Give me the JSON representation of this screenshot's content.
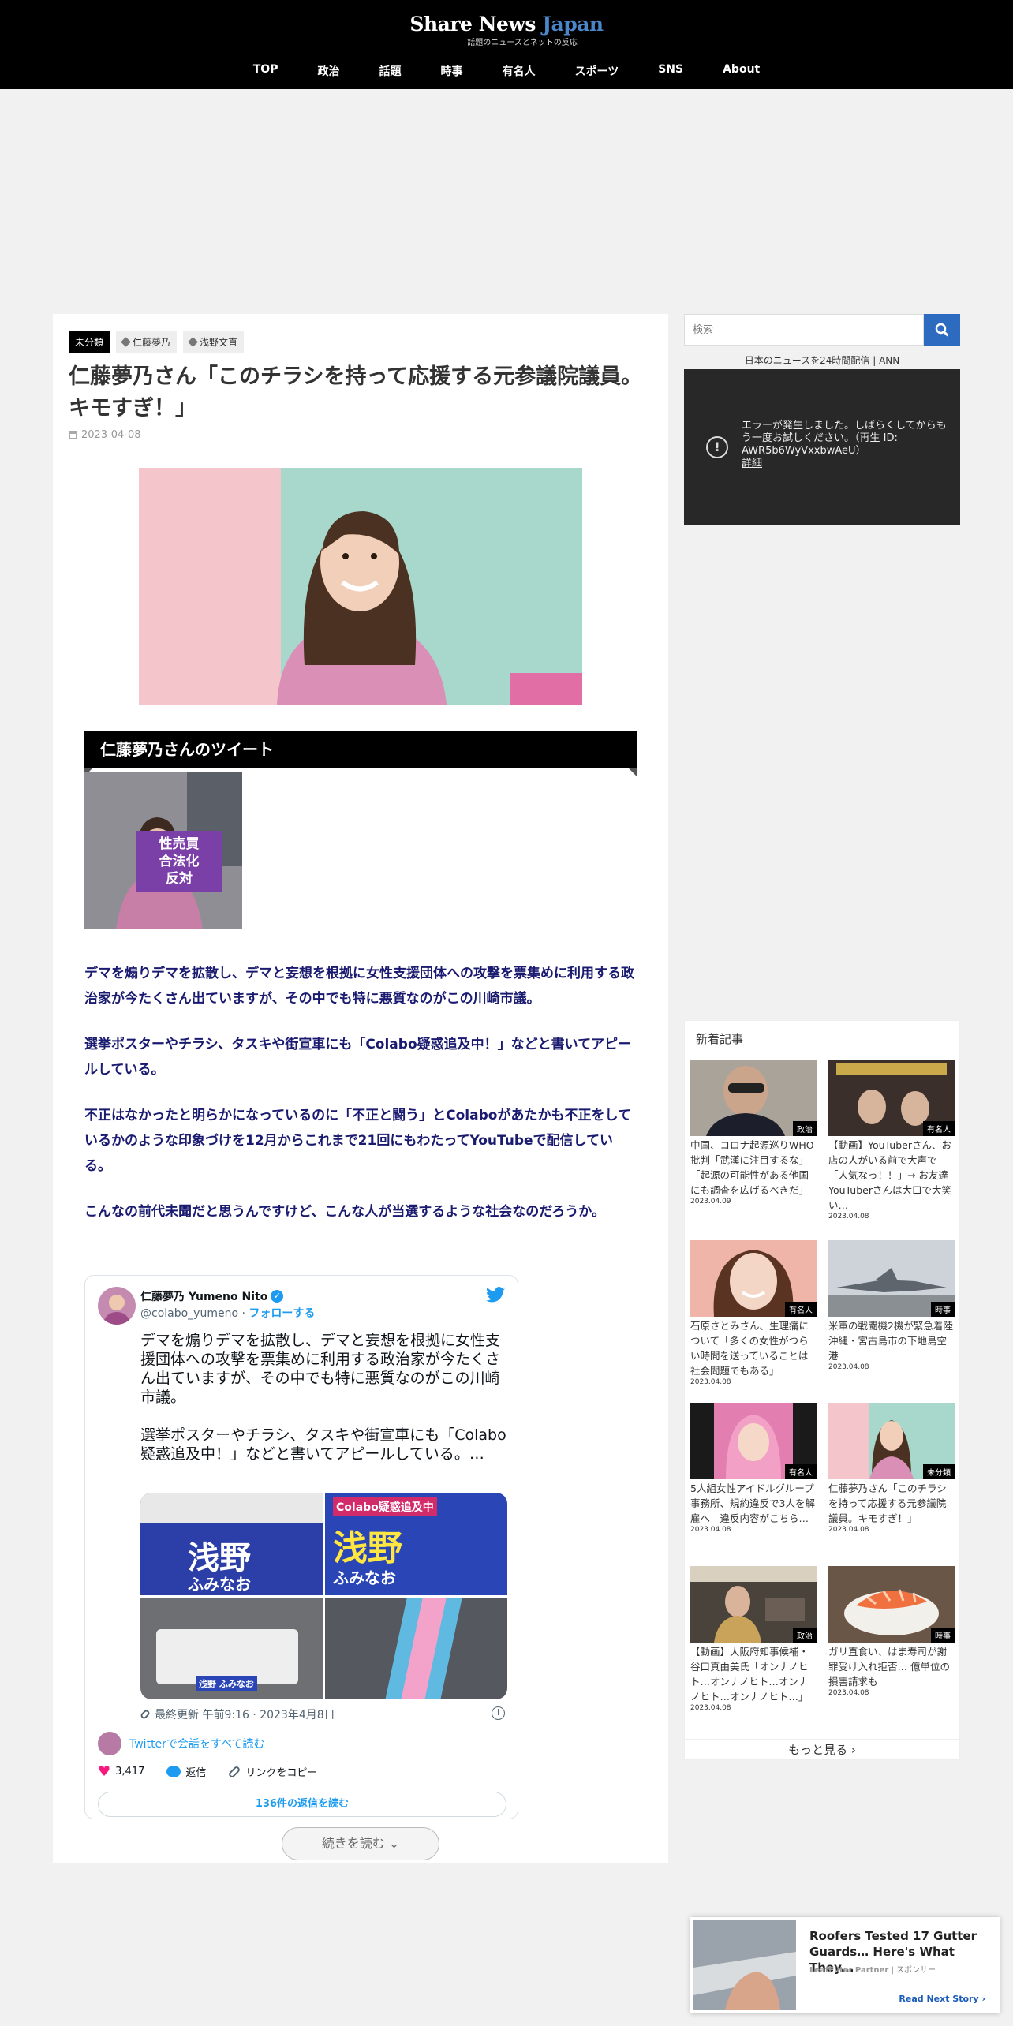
{
  "site": {
    "logo_main": "Share News ",
    "logo_accent": "Japan",
    "logo_sub": "話題のニュースとネットの反応",
    "nav": [
      "TOP",
      "政治",
      "話題",
      "時事",
      "有名人",
      "スポーツ",
      "SNS",
      "About"
    ]
  },
  "article": {
    "category": "未分類",
    "tags": [
      "仁藤夢乃",
      "浅野文直"
    ],
    "title": "仁藤夢乃さん「このチラシを持って応援する元参議院議員。キモすぎ！」",
    "date": "2023-04-08",
    "h2": "仁藤夢乃さんのツイート",
    "thumb_sign": "性売買\n合法化\n反対",
    "paragraphs": [
      "デマを煽りデマを拡散し、デマと妄想を根拠に女性支援団体への攻撃を票集めに利用する政治家が今たくさん出ていますが、その中でも特に悪質なのがこの川崎市議。",
      "選挙ポスターやチラシ、タスキや街宣車にも「Colabo疑惑追及中！」などと書いてアピールしている。",
      "不正はなかったと明らかになっているのに「不正と闘う」とColaboがあたかも不正をしているかのような印象づけを12月からこれまで21回にもわたってYouTubeで配信している。",
      "こんなの前代未聞だと思うんですけど、こんな人が当選するような社会なのだろうか。"
    ],
    "continue_label": "続きを読む ⌄"
  },
  "tweet": {
    "name": "仁藤夢乃 Yumeno Nito",
    "handle": "@colabo_yumeno",
    "follow": "フォローする",
    "text": "デマを煽りデマを拡散し、デマと妄想を根拠に女性支援団体への攻撃を票集めに利用する政治家が今たくさん出ていますが、その中でも特に悪質なのがこの川崎市議。\n\n選挙ポスターやチラシ、タスキや街宣車にも「Colabo疑惑追及中！」などと書いてアピールしている。…",
    "poster1": "浅野",
    "poster1_sub": "ふみなお",
    "poster2_top": "Colabo疑惑追及中",
    "poster2": "浅野",
    "poster2_sub": "ふみなお",
    "poster3": "浅野 ふみなお",
    "timestamp": "最終更新 午前9:16 · 2023年4月8日",
    "info": "i",
    "conversation": "Twitterで会話をすべて読む",
    "likes": "3,417",
    "reply": "返信",
    "copy_link": "リンクをコピー",
    "read_replies": "136件の返信を読む"
  },
  "sidebar": {
    "search_placeholder": "検索",
    "ann_title": "日本のニュースを24時間配信 | ANN",
    "video_error": "エラーが発生しました。しばらくしてからもう一度お試しください。（再生 ID: AWR5b6WyVxxbwAeU）",
    "video_error_link": "詳細",
    "recent_title": "新着記事",
    "more": "もっと見る ›",
    "recent": [
      {
        "text": "中国、コロナ起源巡りWHO批判「武漢に注目するな」「起源の可能性がある他国にも調査を広げるべきだ」",
        "date": "2023.04.09",
        "cat": "政治"
      },
      {
        "text": "【動画】YouTuberさん、お店の人がいる前で大声で「人気なっ！！」→ お友達YouTuberさんは大口で大笑い…",
        "date": "2023.04.08",
        "cat": "有名人"
      },
      {
        "text": "石原さとみさん、生理痛について「多くの女性がつらい時間を送っていることは社会問題でもある」",
        "date": "2023.04.08",
        "cat": "有名人"
      },
      {
        "text": "米軍の戦闘機2機が緊急着陸　沖縄・宮古島市の下地島空港",
        "date": "2023.04.08",
        "cat": "時事"
      },
      {
        "text": "5人組女性アイドルグループ事務所、規約違反で3人を解雇へ　違反内容がこちら…",
        "date": "2023.04.08",
        "cat": "有名人"
      },
      {
        "text": "仁藤夢乃さん「このチラシを持って応援する元参議院議員。キモすぎ！」",
        "date": "2023.04.08",
        "cat": "未分類"
      },
      {
        "text": "【動画】大阪府知事候補・谷口真由美氏「オンナノヒト…オンナノヒト…オンナノヒト…オンナノヒト…」",
        "date": "2023.04.08",
        "cat": "政治"
      },
      {
        "text": "ガリ直食い、はま寿司が謝罪受け入れ拒否… 億単位の損害請求も",
        "date": "2023.04.08",
        "cat": "時事"
      }
    ]
  },
  "ad": {
    "title": "Roofers Tested 17 Gutter Guards… Here's What They...",
    "source": "LeafFilter Partner",
    "sponsor": "スポンサー",
    "cta": "Read Next Story ›"
  },
  "colors": {
    "header": "#000000",
    "accent": "#2c6bbf",
    "body_text": "#1a1a70",
    "twitter": "#1d9bf0"
  }
}
